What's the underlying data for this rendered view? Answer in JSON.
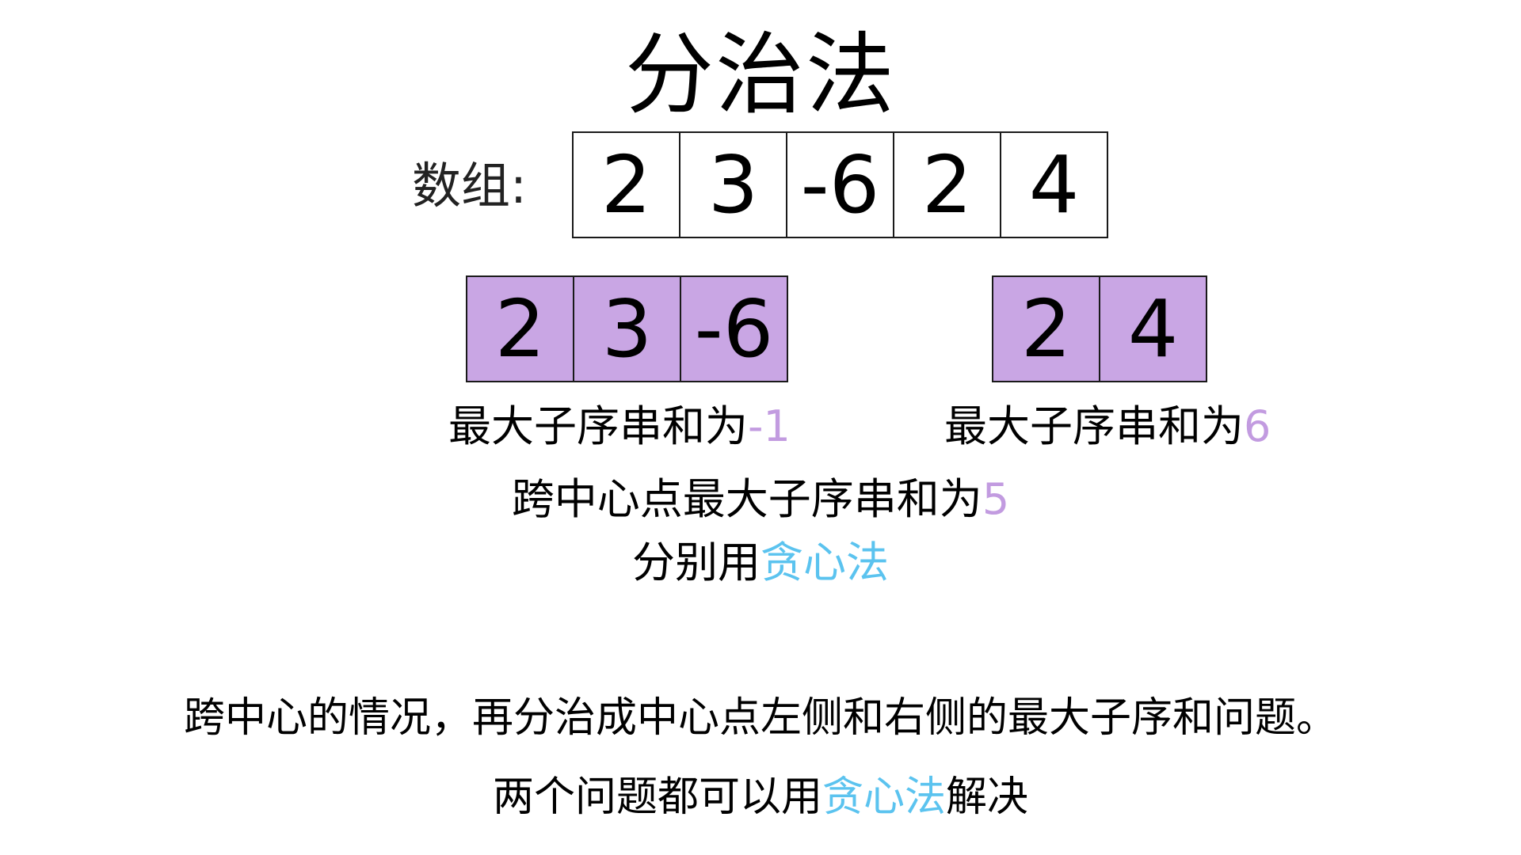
{
  "title": "分治法",
  "array": {
    "label": "数组:",
    "values": [
      "2",
      "3",
      "-6",
      "2",
      "4"
    ]
  },
  "left_half": {
    "values": [
      "2",
      "3",
      "-6"
    ],
    "caption_prefix": "最大子序串和为",
    "caption_value": "-1"
  },
  "right_half": {
    "values": [
      "2",
      "4"
    ],
    "caption_prefix": "最大子序串和为",
    "caption_value": "6"
  },
  "cross": {
    "caption_prefix": "跨中心点最大子序串和为",
    "caption_value": "5"
  },
  "greedy": {
    "prefix": "分别用",
    "method": "贪心法"
  },
  "note": {
    "line1": "跨中心的情况，再分治成中心点左侧和右侧的最大子序和问题。",
    "line2_prefix": "两个问题都可以用",
    "line2_method": "贪心法",
    "line2_suffix": "解决"
  },
  "colors": {
    "highlight_cell": "#c9a6e4",
    "value_text": "#c29be0",
    "method_text": "#5bc3ef"
  }
}
